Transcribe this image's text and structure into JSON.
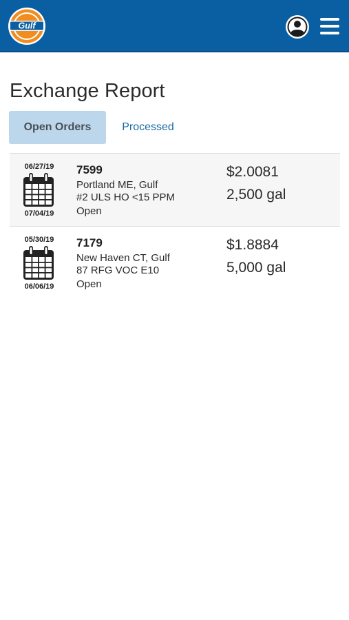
{
  "header": {
    "logo_text": "Gulf",
    "user_icon": "user-circle-icon",
    "menu_icon": "hamburger-menu-icon",
    "bar_color": "#0a5fa3",
    "logo_orange": "#f28c1e"
  },
  "page": {
    "title": "Exchange Report"
  },
  "tabs": [
    {
      "label": "Open Orders",
      "active": true
    },
    {
      "label": "Processed",
      "active": false
    }
  ],
  "orders": [
    {
      "start_date": "06/27/19",
      "end_date": "07/04/19",
      "id": "7599",
      "location": "Portland ME, Gulf",
      "product": "#2 ULS HO <15 PPM",
      "status": "Open",
      "price": "$2.0081",
      "volume": "2,500 gal"
    },
    {
      "start_date": "05/30/19",
      "end_date": "06/06/19",
      "id": "7179",
      "location": "New Haven CT, Gulf",
      "product": "87 RFG VOC E10",
      "status": "Open",
      "price": "$1.8884",
      "volume": "5,000 gal"
    }
  ]
}
